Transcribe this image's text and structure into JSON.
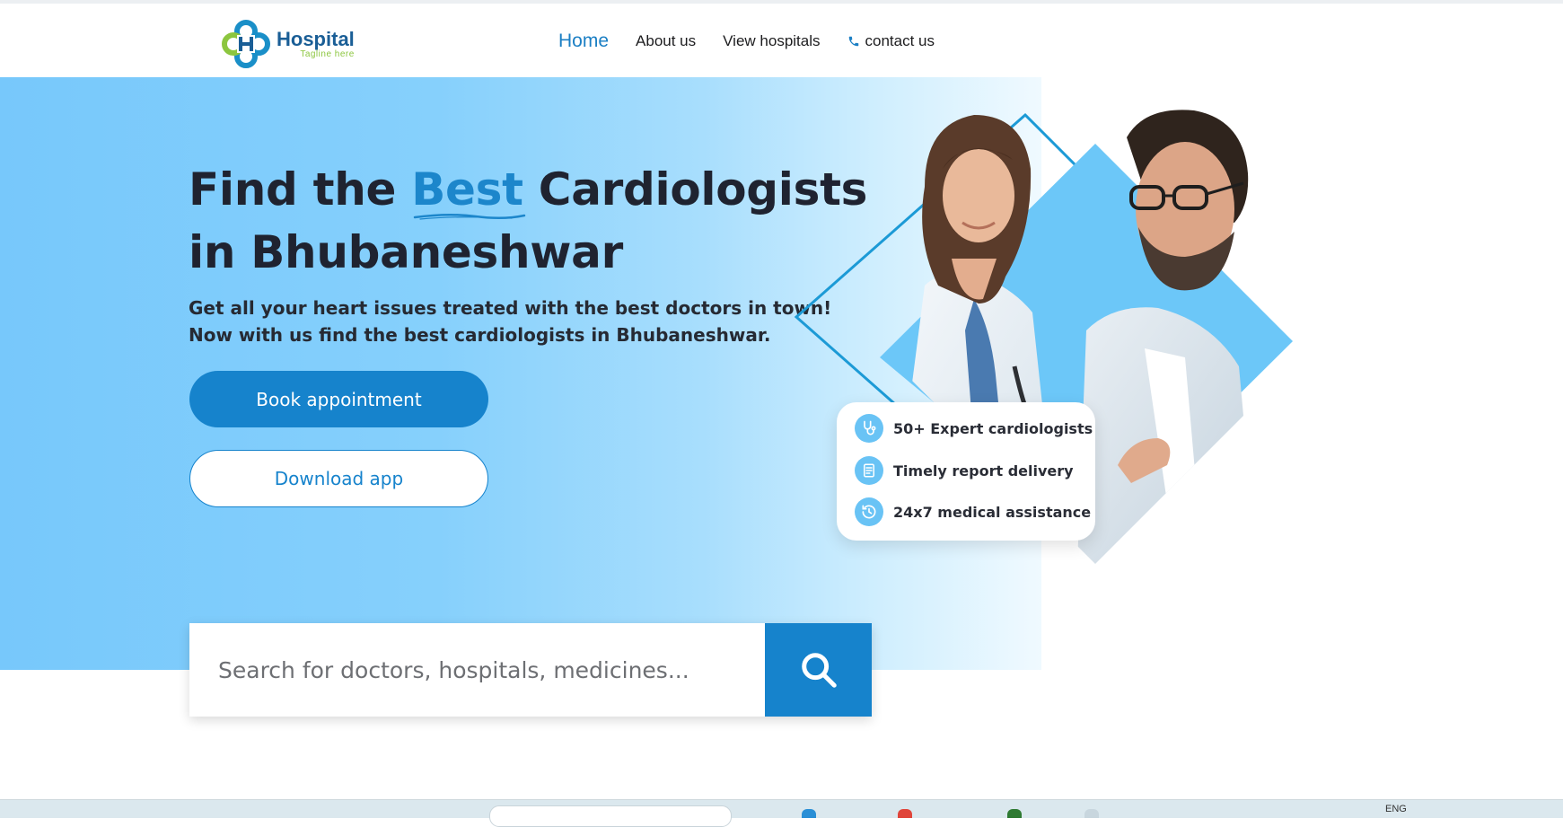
{
  "header": {
    "logo": {
      "name": "Hospital",
      "tagline": "Tagline here"
    },
    "nav": [
      {
        "label": "Home",
        "active": true
      },
      {
        "label": "About us"
      },
      {
        "label": "View hospitals"
      },
      {
        "label": "contact us",
        "icon": "phone-icon"
      }
    ]
  },
  "hero": {
    "title_part1": "Find the ",
    "title_highlight": "Best",
    "title_part2": " Cardiologists",
    "title_line2": "in Bhubaneshwar",
    "subtitle_line1": "Get all your heart issues treated with the best doctors in town!",
    "subtitle_line2": "Now with us find the best cardiologists in Bhubaneshwar.",
    "primary_button": "Book appointment",
    "secondary_button": "Download app"
  },
  "features": [
    {
      "label": "50+ Expert cardiologists",
      "icon": "stethoscope-icon"
    },
    {
      "label": "Timely report delivery",
      "icon": "report-icon"
    },
    {
      "label": "24x7 medical assistance",
      "icon": "clock-history-icon"
    }
  ],
  "search": {
    "placeholder": "Search for doctors, hospitals, medicines...",
    "button_icon": "search-icon"
  },
  "taskbar": {
    "tray_text": "ENG"
  },
  "colors": {
    "accent": "#1683cc",
    "hero_light_blue": "#77c8fb",
    "heading": "#1f2330",
    "logo_green": "#8cc63f"
  }
}
